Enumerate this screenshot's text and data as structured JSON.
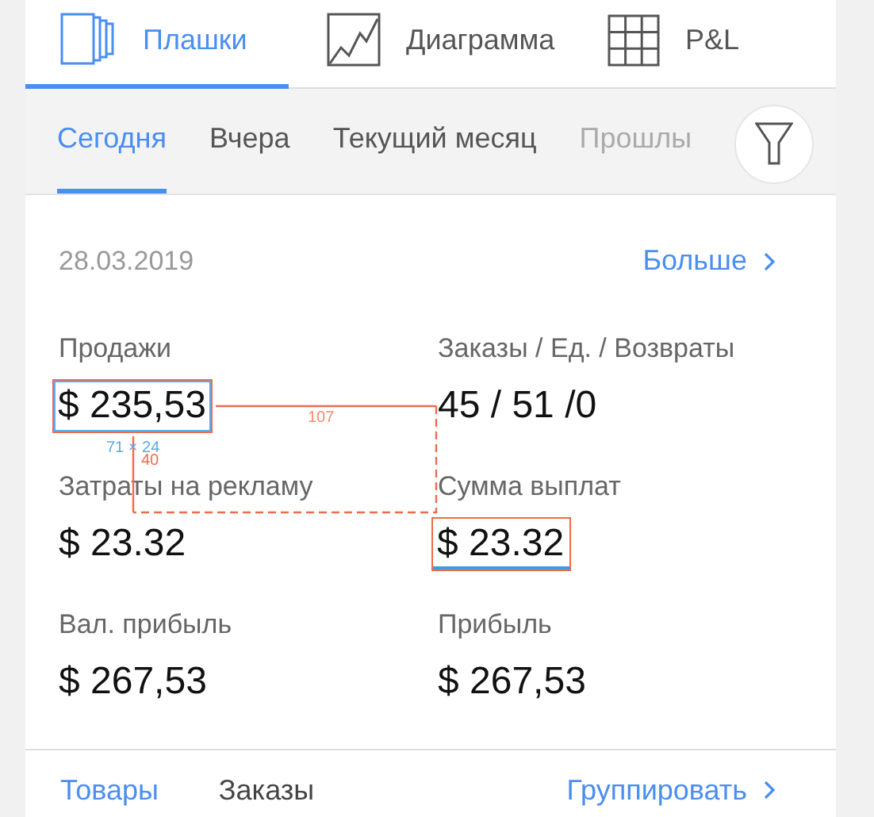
{
  "view_tabs": [
    {
      "label": "Плашки",
      "kind": "cards",
      "selected": true
    },
    {
      "label": "Диаграмма",
      "kind": "chart",
      "selected": false
    },
    {
      "label": "P&L",
      "kind": "grid",
      "selected": false
    }
  ],
  "periods": [
    {
      "label": "Сегодня",
      "selected": true,
      "faded": false
    },
    {
      "label": "Вчера",
      "selected": false,
      "faded": false
    },
    {
      "label": "Текущий месяц",
      "selected": false,
      "faded": false
    },
    {
      "label": "Прошлы",
      "selected": false,
      "faded": true
    }
  ],
  "card": {
    "date": "28.03.2019",
    "more_link": "Больше",
    "metrics": [
      {
        "label": "Продажи",
        "value": "$ 235,53",
        "kind": "boxed"
      },
      {
        "label": "Заказы / Ед. / Возвраты",
        "value": "45 / 51 /0",
        "kind": "plain"
      },
      {
        "label": "Затраты на рекламу",
        "value": "$ 23.32",
        "kind": "plain"
      },
      {
        "label": "Сумма выплат",
        "value": "$ 23.32",
        "kind": "underlined"
      },
      {
        "label": "Вал. прибыль",
        "value": "$ 267,53",
        "kind": "plain"
      },
      {
        "label": "Прибыль",
        "value": "$ 267,53",
        "kind": "plain"
      }
    ]
  },
  "measurements": {
    "width_label": "107",
    "size_label": "71 × 24",
    "height_label": "40"
  },
  "bottom_tabs": [
    {
      "label": "Товары",
      "selected": true
    },
    {
      "label": "Заказы",
      "selected": false
    }
  ],
  "group_link": "Группировать"
}
